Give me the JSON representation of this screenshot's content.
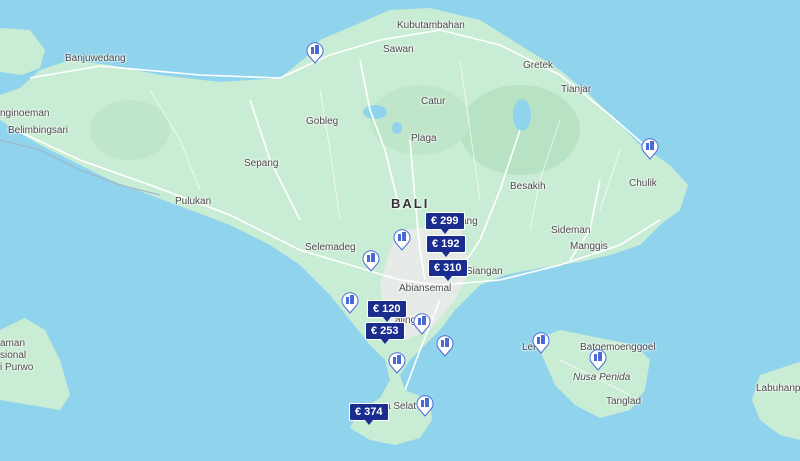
{
  "map": {
    "colors": {
      "sea": "#8fd3ec",
      "land": "#c9ecd4",
      "road": "#ffffff",
      "accent": "#1a2d8f"
    },
    "region_label": "BALI",
    "places": [
      {
        "id": "kubutambahan",
        "label": "Kubutambahan"
      },
      {
        "id": "sawan",
        "label": "Sawan"
      },
      {
        "id": "banjuwedang",
        "label": "Banjuwedang"
      },
      {
        "id": "gretek",
        "label": "Gretek"
      },
      {
        "id": "tianjar",
        "label": "Tianjar"
      },
      {
        "id": "ngingoeman",
        "label": "nginoeman"
      },
      {
        "id": "belimbingsari",
        "label": "Belimbingsari"
      },
      {
        "id": "catur",
        "label": "Catur"
      },
      {
        "id": "gobleg",
        "label": "Gobleg"
      },
      {
        "id": "plaga",
        "label": "Plaga"
      },
      {
        "id": "sepang",
        "label": "Sepang"
      },
      {
        "id": "chulik",
        "label": "Chulik"
      },
      {
        "id": "besakih",
        "label": "Besakih"
      },
      {
        "id": "pulukan",
        "label": "Pulukan"
      },
      {
        "id": "tang",
        "label": "ang"
      },
      {
        "id": "sideman",
        "label": "Sideman"
      },
      {
        "id": "manggis",
        "label": "Manggis"
      },
      {
        "id": "selemadeg",
        "label": "Selemadeg"
      },
      {
        "id": "siangan",
        "label": "Siangan"
      },
      {
        "id": "abiansemal",
        "label": "Abiansemal"
      },
      {
        "id": "kaling",
        "label": "aling"
      },
      {
        "id": "lembongan",
        "label": "Lem"
      },
      {
        "id": "batoemoenggoel",
        "label": "Batoemoenggoel"
      },
      {
        "id": "nusa-penida",
        "label": "Nusa Penida"
      },
      {
        "id": "tanglad",
        "label": "Tanglad"
      },
      {
        "id": "labuhanpo",
        "label": "Labuhanpo"
      },
      {
        "id": "kuta-selatan",
        "label": "a Selat"
      },
      {
        "id": "aman",
        "label": "aman"
      },
      {
        "id": "sional",
        "label": "sional"
      },
      {
        "id": "purwo",
        "label": "i Purwo"
      }
    ],
    "price_pins": [
      {
        "id": "299",
        "label": "€ 299"
      },
      {
        "id": "192",
        "label": "€ 192"
      },
      {
        "id": "310",
        "label": "€ 310"
      },
      {
        "id": "120",
        "label": "€ 120"
      },
      {
        "id": "253",
        "label": "€ 253"
      },
      {
        "id": "374",
        "label": "€ 374"
      }
    ],
    "hotel_pin_icon": "hotel-building-icon"
  }
}
